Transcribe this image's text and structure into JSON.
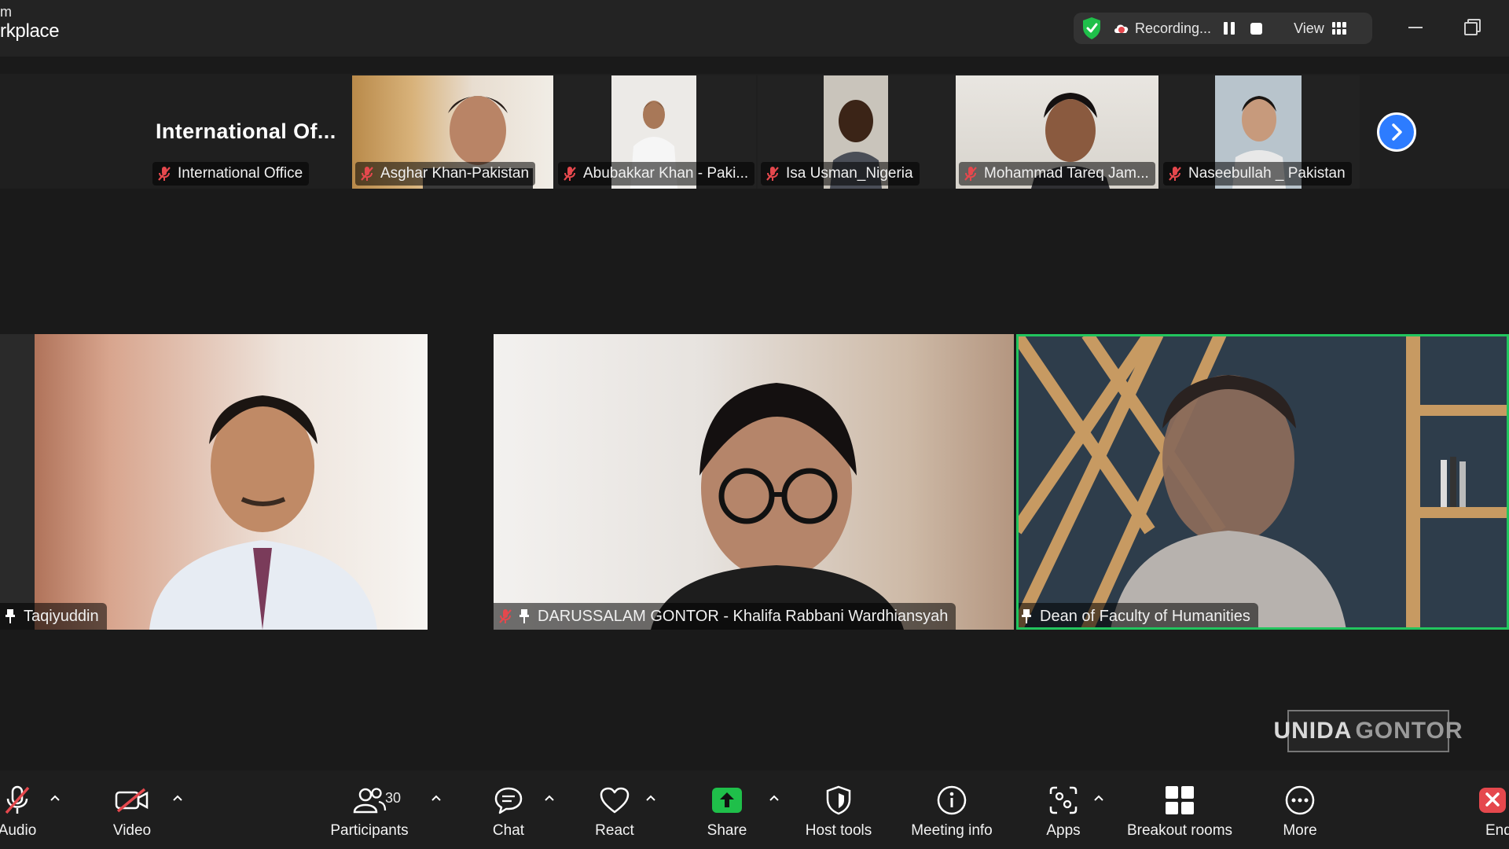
{
  "window": {
    "brand_line1": "m",
    "brand_line2": "rkplace"
  },
  "recording": {
    "status": "Recording...",
    "view_label": "View"
  },
  "filmstrip": {
    "tiles": [
      {
        "name": "International Office",
        "display_title": "International  Of..."
      },
      {
        "name": "Asghar Khan-Pakistan"
      },
      {
        "name": "Abubakkar Khan - Paki..."
      },
      {
        "name": "Isa Usman_Nigeria"
      },
      {
        "name": "Mohammad Tareq Jam..."
      },
      {
        "name": "Naseebullah _ Pakistan"
      }
    ]
  },
  "main": {
    "tiles": [
      {
        "name": "Taqiyuddin"
      },
      {
        "name": "DARUSSALAM GONTOR - Khalifa Rabbani Wardhiansyah"
      },
      {
        "name": "Dean of Faculty of Humanities"
      }
    ]
  },
  "watermark": {
    "part1": "UNIDA",
    "part2": "GONTOR"
  },
  "toolbar": {
    "audio": "Audio",
    "video": "Video",
    "participants": "Participants",
    "participant_count": "30",
    "chat": "Chat",
    "react": "React",
    "share": "Share",
    "host_tools": "Host tools",
    "meeting_info": "Meeting info",
    "apps": "Apps",
    "breakout_rooms": "Breakout rooms",
    "more": "More",
    "end": "End"
  },
  "colors": {
    "active_speaker": "#22c55e",
    "share_green": "#1fbf4a",
    "mute_red": "#e5484d",
    "accent_blue": "#2d7cff"
  }
}
